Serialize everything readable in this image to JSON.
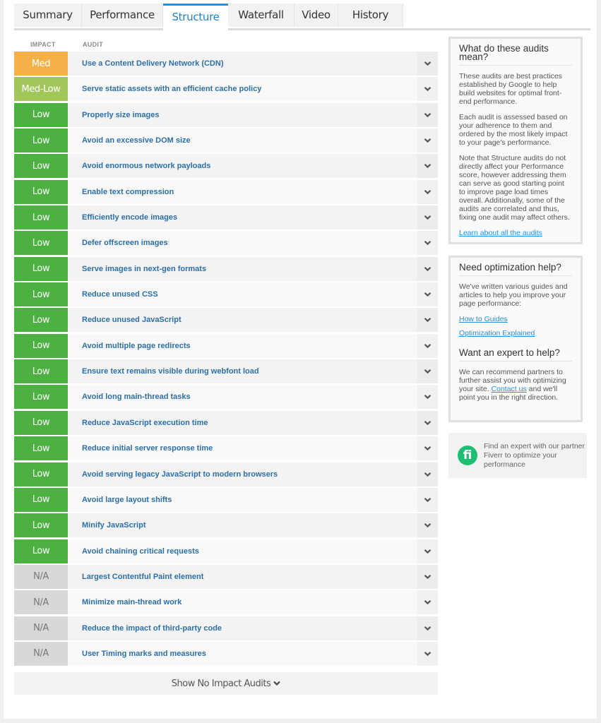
{
  "tabs": [
    {
      "label": "Summary",
      "active": false
    },
    {
      "label": "Performance",
      "active": false
    },
    {
      "label": "Structure",
      "active": true
    },
    {
      "label": "Waterfall",
      "active": false
    },
    {
      "label": "Video",
      "active": false
    },
    {
      "label": "History",
      "active": false
    }
  ],
  "columns": {
    "impact": "IMPACT",
    "audit": "AUDIT"
  },
  "impact_colors": {
    "Med": "#f5b04a",
    "Med-Low": "#a3c65a",
    "Low": "#4cb140",
    "N/A": "#d8d8d8"
  },
  "audits": [
    {
      "impact": "Med",
      "title": "Use a Content Delivery Network (CDN)"
    },
    {
      "impact": "Med-Low",
      "title": "Serve static assets with an efficient cache policy"
    },
    {
      "impact": "Low",
      "title": "Properly size images"
    },
    {
      "impact": "Low",
      "title": "Avoid an excessive DOM size"
    },
    {
      "impact": "Low",
      "title": "Avoid enormous network payloads"
    },
    {
      "impact": "Low",
      "title": "Enable text compression"
    },
    {
      "impact": "Low",
      "title": "Efficiently encode images"
    },
    {
      "impact": "Low",
      "title": "Defer offscreen images"
    },
    {
      "impact": "Low",
      "title": "Serve images in next-gen formats"
    },
    {
      "impact": "Low",
      "title": "Reduce unused CSS"
    },
    {
      "impact": "Low",
      "title": "Reduce unused JavaScript"
    },
    {
      "impact": "Low",
      "title": "Avoid multiple page redirects"
    },
    {
      "impact": "Low",
      "title": "Ensure text remains visible during webfont load"
    },
    {
      "impact": "Low",
      "title": "Avoid long main-thread tasks"
    },
    {
      "impact": "Low",
      "title": "Reduce JavaScript execution time"
    },
    {
      "impact": "Low",
      "title": "Reduce initial server response time"
    },
    {
      "impact": "Low",
      "title": "Avoid serving legacy JavaScript to modern browsers"
    },
    {
      "impact": "Low",
      "title": "Avoid large layout shifts"
    },
    {
      "impact": "Low",
      "title": "Minify JavaScript"
    },
    {
      "impact": "Low",
      "title": "Avoid chaining critical requests"
    },
    {
      "impact": "N/A",
      "title": "Largest Contentful Paint element"
    },
    {
      "impact": "N/A",
      "title": "Minimize main-thread work"
    },
    {
      "impact": "N/A",
      "title": "Reduce the impact of third-party code"
    },
    {
      "impact": "N/A",
      "title": "User Timing marks and measures"
    }
  ],
  "show_more_label": "Show No Impact Audits",
  "sidebar": {
    "about": {
      "title": "What do these audits mean?",
      "p1": "These audits are best practices established by Google to help build websites for optimal front-end performance.",
      "p2": "Each audit is assessed based on your adherence to them and ordered by the most likely impact to your page's performance.",
      "p3": "Note that Structure audits do not directly affect your Performance score, however addressing them can serve as good starting point to improve page load times overall. Additionally, some of the audits are correlated and thus, fixing one audit may affect others.",
      "link": "Learn about all the audits"
    },
    "help": {
      "title": "Need optimization help?",
      "p1": "We've written various guides and articles to help you improve your page performance:",
      "link1": "How to Guides",
      "link2": "Optimization Explained",
      "title2": "Want an expert to help?",
      "p2_before": "We can recommend partners to further assist you with optimizing your site. ",
      "p2_link": "Contact us",
      "p2_after": " and we'll point you in the right direction."
    },
    "fiverr": {
      "logo_text": "fi",
      "text": "Find an expert with our partner Fiverr to optimize your performance"
    }
  }
}
